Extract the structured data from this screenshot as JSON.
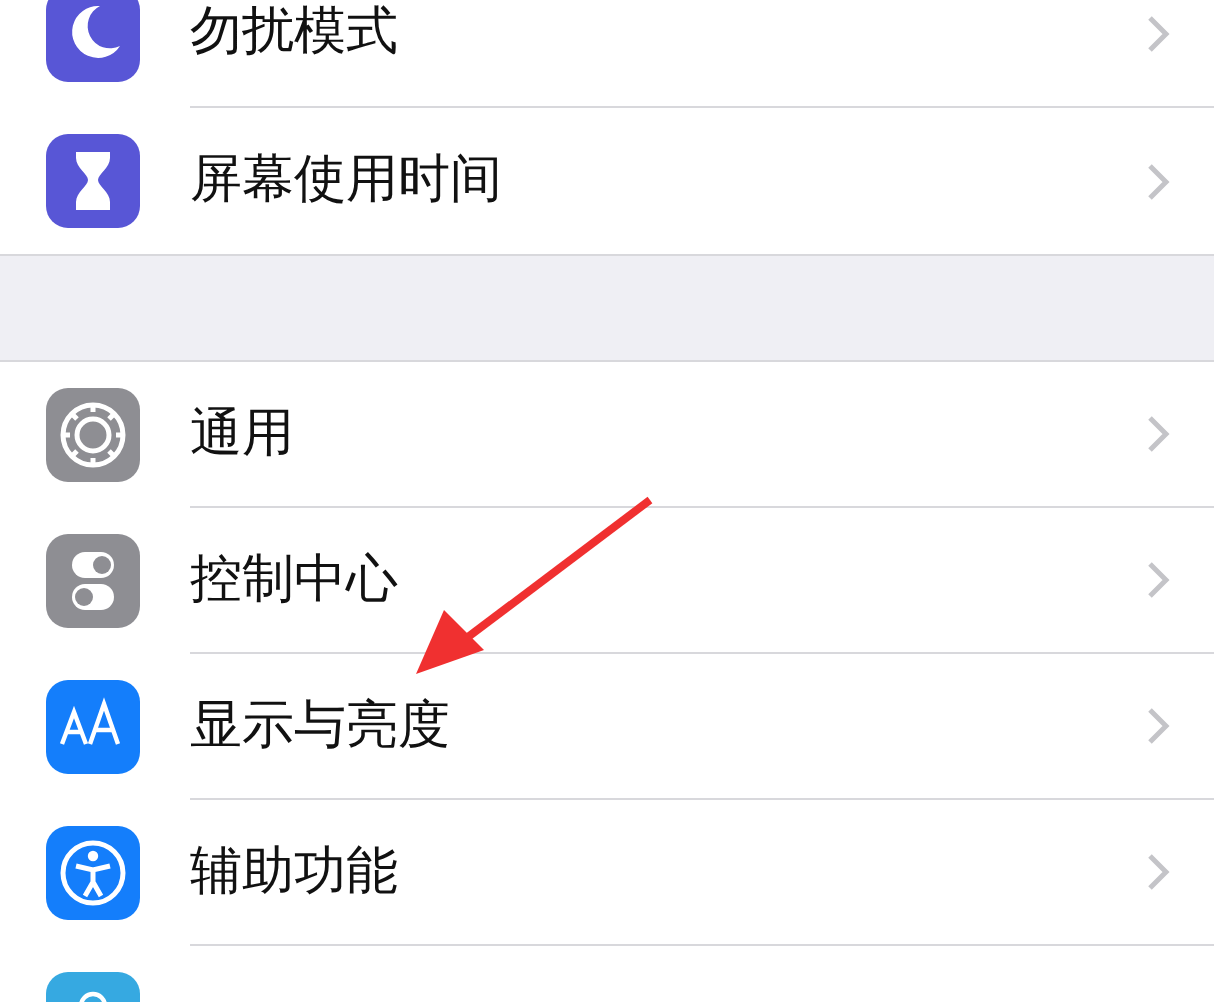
{
  "groups": [
    {
      "items": [
        {
          "kind": "moon",
          "label": "勿扰模式",
          "color": "#5856d6"
        },
        {
          "kind": "hourglass",
          "label": "屏幕使用时间",
          "color": "#5856d6"
        }
      ]
    },
    {
      "items": [
        {
          "kind": "gear",
          "label": "通用",
          "color": "#8e8e93"
        },
        {
          "kind": "toggles",
          "label": "控制中心",
          "color": "#8e8e93"
        },
        {
          "kind": "text-size",
          "label": "显示与亮度",
          "color": "#147efb"
        },
        {
          "kind": "accessibility",
          "label": "辅助功能",
          "color": "#147efb"
        },
        {
          "kind": "flower",
          "color": "#36a9e1"
        }
      ]
    }
  ],
  "annotation": {
    "kind": "arrow"
  }
}
